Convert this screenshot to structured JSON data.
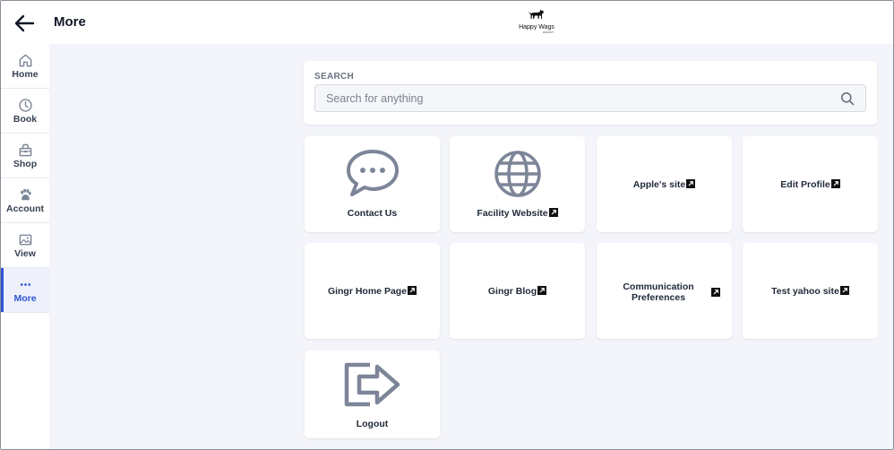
{
  "header": {
    "title": "More",
    "logo_text": "Happy Wags",
    "logo_subtext": "RESORT"
  },
  "sidebar": {
    "items": [
      {
        "label": "Home",
        "icon": "home-icon",
        "active": false
      },
      {
        "label": "Book",
        "icon": "clock-icon",
        "active": false
      },
      {
        "label": "Shop",
        "icon": "shop-icon",
        "active": false
      },
      {
        "label": "Account",
        "icon": "paw-icon",
        "active": false
      },
      {
        "label": "View",
        "icon": "image-icon",
        "active": false
      },
      {
        "label": "More",
        "icon": "more-dots-icon",
        "active": true
      }
    ]
  },
  "search": {
    "label": "SEARCH",
    "placeholder": "Search for anything",
    "value": ""
  },
  "tiles": [
    {
      "label": "Contact Us",
      "icon": "chat-bubble-icon",
      "external": false
    },
    {
      "label": "Facility Website",
      "icon": "globe-icon",
      "external": true
    },
    {
      "label": "Apple's site",
      "external": true
    },
    {
      "label": "Edit Profile",
      "external": true
    },
    {
      "label": "Gingr Home Page",
      "external": true
    },
    {
      "label": "Gingr Blog",
      "external": true
    },
    {
      "label_line1": "Communication",
      "label_line2": "Preferences",
      "external": true
    },
    {
      "label": "Test yahoo site",
      "external": true
    },
    {
      "label": "Logout",
      "icon": "logout-icon",
      "external": false
    }
  ],
  "colors": {
    "accent": "#2f54d6",
    "background": "#f4f5fa",
    "icon_gray": "#7d8598"
  }
}
